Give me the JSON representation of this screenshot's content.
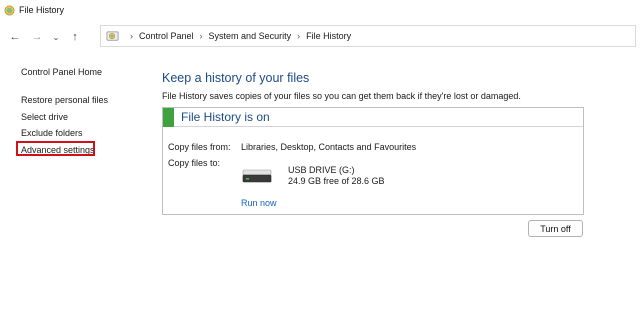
{
  "window": {
    "title": "File History",
    "icon": "file-history-icon"
  },
  "nav": {
    "back_icon": "←",
    "forward_icon": "→",
    "recent_icon": "⌄",
    "up_icon": "↑",
    "breadcrumb": [
      "Control Panel",
      "System and Security",
      "File History"
    ],
    "separator": "›"
  },
  "sidebar": {
    "home": "Control Panel Home",
    "links": [
      "Restore personal files",
      "Select drive",
      "Exclude folders",
      "Advanced settings"
    ],
    "highlighted_index": 3,
    "highlight_color": "#d0101a"
  },
  "main": {
    "heading": "Keep a history of your files",
    "description": "File History saves copies of your files so you can get them back if they're lost or damaged."
  },
  "status": {
    "title": "File History is on",
    "accent_color": "#3ea33e",
    "copy_from_label": "Copy files from:",
    "copy_from_value": "Libraries, Desktop, Contacts and Favourites",
    "copy_to_label": "Copy files to:",
    "drive_name": "USB DRIVE (G:)",
    "drive_space": "24.9 GB free of 28.6 GB",
    "run_now": "Run now"
  },
  "actions": {
    "turn_off": "Turn off"
  }
}
